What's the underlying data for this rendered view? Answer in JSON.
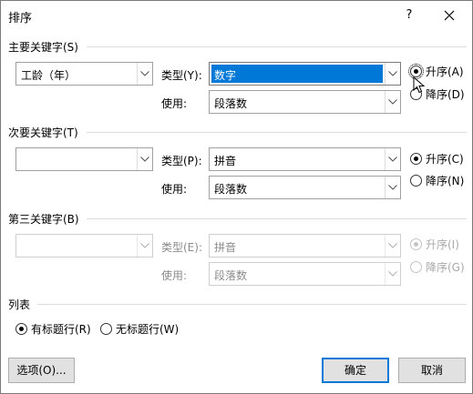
{
  "dialog": {
    "title": "排序",
    "help": "?"
  },
  "primary": {
    "section_label": "主要关键字(S)",
    "field_value": "工龄（年）",
    "type_label": "类型(Y):",
    "type_value": "数字",
    "using_label": "使用:",
    "using_value": "段落数",
    "asc_label": "升序(A)",
    "desc_label": "降序(D)",
    "order": "ascending"
  },
  "secondary": {
    "section_label": "次要关键字(T)",
    "field_value": "",
    "type_label": "类型(P):",
    "type_value": "拼音",
    "using_label": "使用:",
    "using_value": "段落数",
    "asc_label": "升序(C)",
    "desc_label": "降序(N)",
    "order": "ascending"
  },
  "tertiary": {
    "section_label": "第三关键字(B)",
    "field_value": "",
    "type_label": "类型(E):",
    "type_value": "拼音",
    "using_label": "使用:",
    "using_value": "段落数",
    "asc_label": "升序(I)",
    "desc_label": "降序(G)",
    "order": "ascending",
    "disabled": true
  },
  "list": {
    "section_label": "列表",
    "header_row_label": "有标题行(R)",
    "no_header_row_label": "无标题行(W)",
    "selected": "header_row"
  },
  "buttons": {
    "options": "选项(O)...",
    "ok": "确定",
    "cancel": "取消"
  },
  "colors": {
    "accent": "#0078d7",
    "disabled_text": "#8c8c8c"
  },
  "icons": {
    "close": "close-icon",
    "dropdown": "chevron-down-icon",
    "pointer": "mouse-pointer-icon"
  }
}
